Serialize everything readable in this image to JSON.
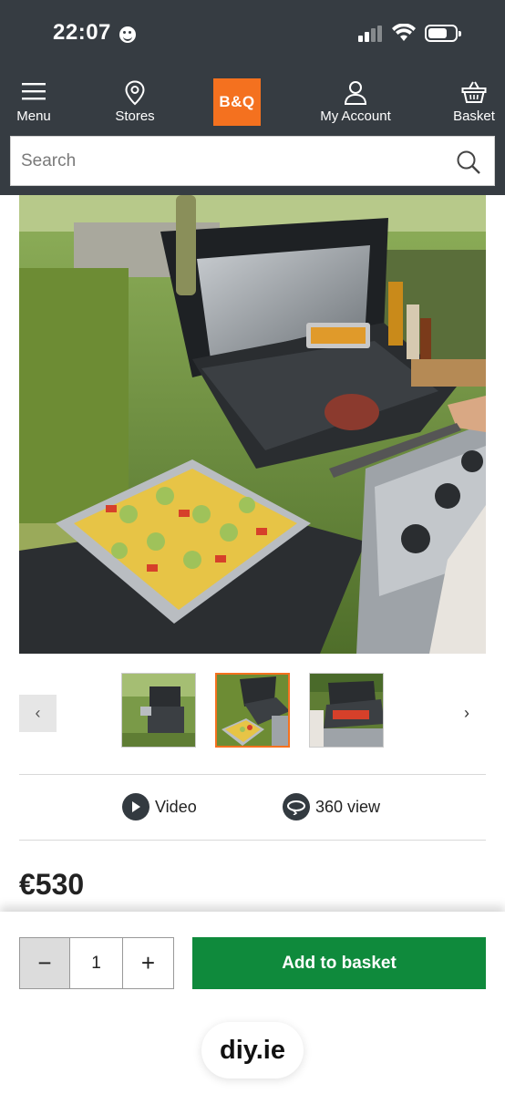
{
  "status_bar": {
    "time": "22:07"
  },
  "nav": {
    "menu_label": "Menu",
    "stores_label": "Stores",
    "logo_text": "B&Q",
    "account_label": "My Account",
    "basket_label": "Basket"
  },
  "search": {
    "placeholder": "Search"
  },
  "gallery": {
    "prev_symbol": "‹",
    "next_symbol": "›",
    "thumbnail_count": 3,
    "active_thumbnail": 2
  },
  "media": {
    "video_label": "Video",
    "view360_label": "360 view"
  },
  "product": {
    "price": "€530"
  },
  "purchase": {
    "minus_symbol": "−",
    "quantity": "1",
    "plus_symbol": "+",
    "add_label": "Add to basket"
  },
  "browser": {
    "domain": "diy.ie"
  },
  "colors": {
    "header_bg": "#363c42",
    "brand_orange": "#f4711f",
    "add_green": "#0f8a3c"
  }
}
